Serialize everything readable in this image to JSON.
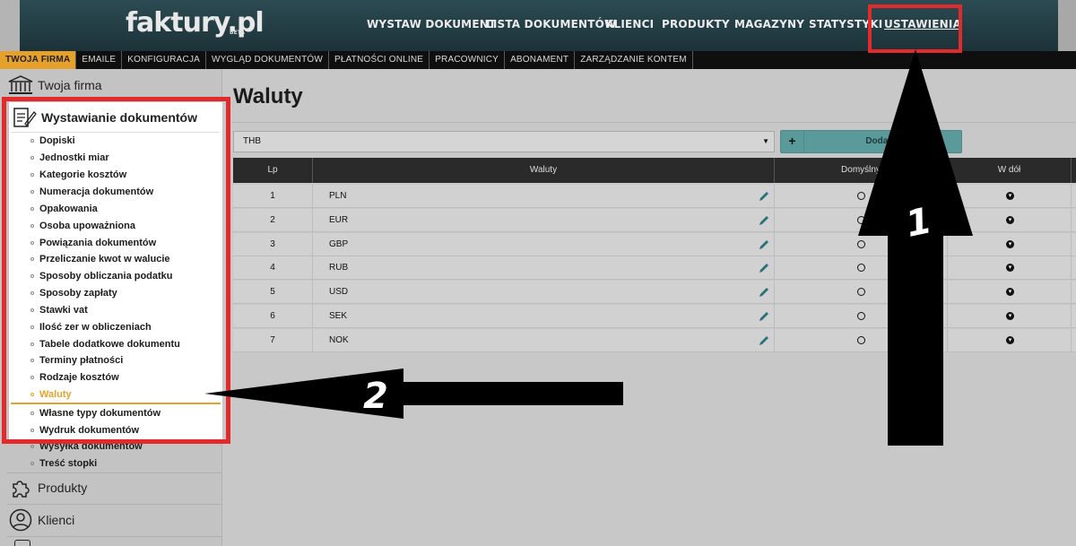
{
  "header": {
    "logo": "faktury.pl",
    "logo_badge": "BETA",
    "nav": [
      {
        "label": "WYSTAW DOKUMENT"
      },
      {
        "label": "LISTA DOKUMENTÓW"
      },
      {
        "label": "KLIENCI"
      },
      {
        "label": "PRODUKTY"
      },
      {
        "label": "MAGAZYNY"
      },
      {
        "label": "STATYSTYKI"
      },
      {
        "label": "USTAWIENIA"
      }
    ]
  },
  "subnav": [
    {
      "label": "TWOJA FIRMA"
    },
    {
      "label": "EMAILE"
    },
    {
      "label": "KONFIGURACJA"
    },
    {
      "label": "WYGLĄD DOKUMENTÓW"
    },
    {
      "label": "PŁATNOŚCI ONLINE"
    },
    {
      "label": "PRACOWNICY"
    },
    {
      "label": "ABONAMENT"
    },
    {
      "label": "ZARZĄDZANIE KONTEM"
    }
  ],
  "sidebar": {
    "sections": {
      "company": "Twoja firma",
      "documents": "Wystawianie dokumentów",
      "products": "Produkty",
      "clients": "Klienci"
    },
    "items": [
      {
        "label": "Dopiski"
      },
      {
        "label": "Jednostki miar"
      },
      {
        "label": "Kategorie kosztów"
      },
      {
        "label": "Numeracja dokumentów"
      },
      {
        "label": "Opakowania"
      },
      {
        "label": "Osoba upoważniona"
      },
      {
        "label": "Powiązania dokumentów"
      },
      {
        "label": "Przeliczanie kwot w walucie"
      },
      {
        "label": "Sposoby obliczania podatku"
      },
      {
        "label": "Sposoby zapłaty"
      },
      {
        "label": "Stawki vat"
      },
      {
        "label": "Ilość zer w obliczeniach"
      },
      {
        "label": "Tabele dodatkowe dokumentu"
      },
      {
        "label": "Terminy płatności"
      },
      {
        "label": "Rodzaje kosztów"
      },
      {
        "label": "Waluty",
        "active": true
      },
      {
        "label": "Własne typy dokumentów"
      },
      {
        "label": "Wydruk dokumentów"
      },
      {
        "label": "Wysyłka dokumentów"
      },
      {
        "label": "Treść stopki"
      }
    ]
  },
  "main": {
    "title": "Waluty",
    "currency_select": "THB",
    "add_button": "Dodaj w",
    "columns": [
      "Lp",
      "Waluty",
      "Domyślny",
      "W dół"
    ],
    "rows": [
      {
        "lp": "1",
        "currency": "PLN"
      },
      {
        "lp": "2",
        "currency": "EUR"
      },
      {
        "lp": "3",
        "currency": "GBP"
      },
      {
        "lp": "4",
        "currency": "RUB"
      },
      {
        "lp": "5",
        "currency": "USD"
      },
      {
        "lp": "6",
        "currency": "SEK"
      },
      {
        "lp": "7",
        "currency": "NOK"
      }
    ]
  },
  "annotations": {
    "arrow1_label": "1",
    "arrow2_label": "2",
    "box_color": "#e22a2a"
  },
  "colors": {
    "accent": "#e6a12c",
    "header_bg": "#1c3238",
    "button": "#5b9a9a"
  }
}
